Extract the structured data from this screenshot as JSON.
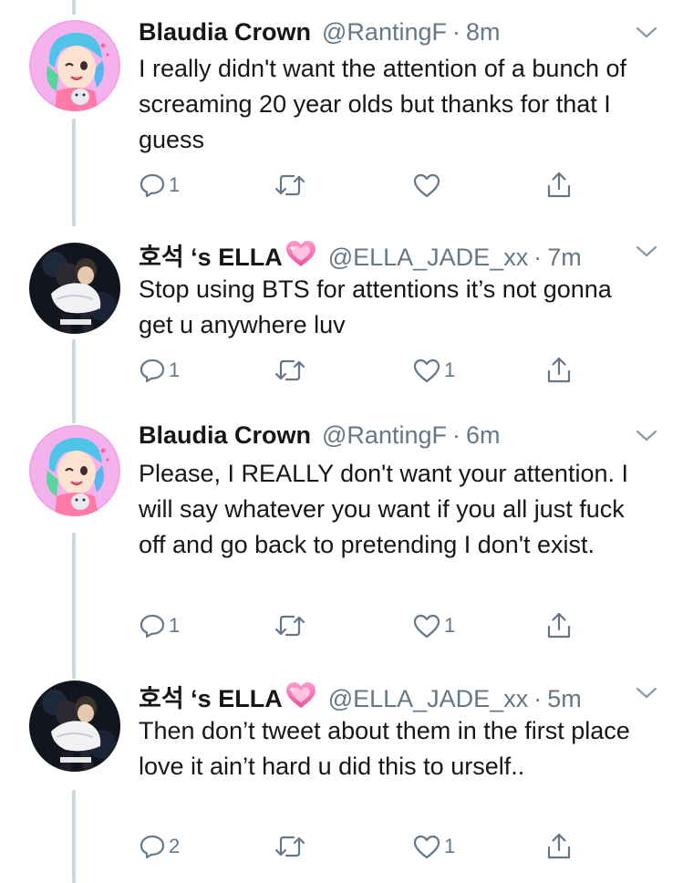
{
  "tweets": [
    {
      "name": "Blaudia Crown",
      "has_heart_emoji": false,
      "handle": "@RantingF",
      "separator": "·",
      "time": "8m",
      "text": "I really didn't want the attention of a bunch of screaming 20 year olds but thanks for that I guess",
      "reply_count": "1",
      "retweet_count": "",
      "like_count": ""
    },
    {
      "name": "호석 ‘s ELLA",
      "has_heart_emoji": true,
      "handle": "@ELLA_JADE_xx",
      "separator": "·",
      "time": "7m",
      "text": "Stop using BTS for attentions it’s not gonna get u anywhere luv",
      "reply_count": "1",
      "retweet_count": "",
      "like_count": "1"
    },
    {
      "name": "Blaudia Crown",
      "has_heart_emoji": false,
      "handle": "@RantingF",
      "separator": "·",
      "time": "6m",
      "text": "Please, I REALLY don't want your attention. I will say whatever you want if you all just fuck off and go back to pretending I don't exist.",
      "reply_count": "1",
      "retweet_count": "",
      "like_count": "1"
    },
    {
      "name": "호석 ‘s ELLA",
      "has_heart_emoji": true,
      "handle": "@ELLA_JADE_xx",
      "separator": "·",
      "time": "5m",
      "text": "Then don’t tweet about them in the first place love it ain’t hard u did this to urself..",
      "reply_count": "2",
      "retweet_count": "",
      "like_count": "1"
    }
  ],
  "icons": {
    "reply": "reply-icon",
    "retweet": "retweet-icon",
    "like": "like-icon",
    "share": "share-icon",
    "caret": "chevron-down-icon",
    "emoji": "sparkling-heart-emoji"
  },
  "colors": {
    "text": "#14171a",
    "secondary": "#657786",
    "thread_line": "#ccd6dd",
    "heart_emoji": "#f06fa8"
  }
}
